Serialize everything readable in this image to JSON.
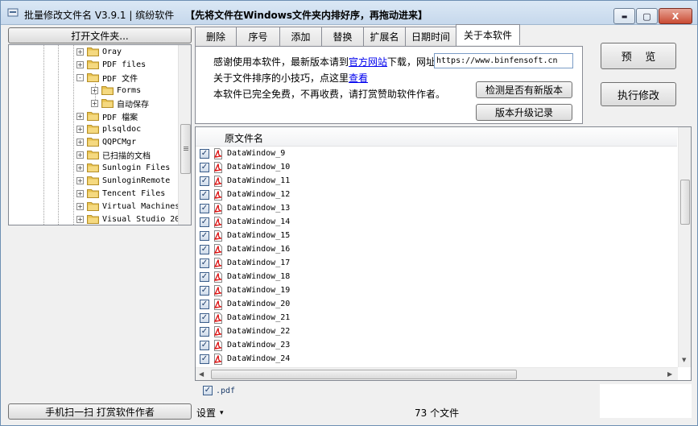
{
  "window": {
    "title_main": "批量修改文件名 V3.9.1 | 缤纷软件",
    "title_hint": "【先将文件在Windows文件夹内排好序，再拖动进来】",
    "min_label": "▬",
    "max_label": "▢",
    "close_label": "X"
  },
  "left": {
    "open_folder_label": "打开文件夹...",
    "donate_label": "手机扫一扫 打赏软件作者",
    "tree_items": [
      {
        "label": "Oray",
        "expander": "+",
        "indent": 0
      },
      {
        "label": "PDF files",
        "expander": "+",
        "indent": 0
      },
      {
        "label": "PDF 文件",
        "expander": "-",
        "indent": 0
      },
      {
        "label": "Forms",
        "expander": "+",
        "indent": 1
      },
      {
        "label": "自动保存",
        "expander": "+",
        "indent": 1
      },
      {
        "label": "PDF 檔案",
        "expander": "+",
        "indent": 0
      },
      {
        "label": "plsqldoc",
        "expander": "+",
        "indent": 0
      },
      {
        "label": "QQPCMgr",
        "expander": "+",
        "indent": 0
      },
      {
        "label": "已扫描的文档",
        "expander": "+",
        "indent": 0
      },
      {
        "label": "Sunlogin Files",
        "expander": "+",
        "indent": 0
      },
      {
        "label": "SunloginRemote",
        "expander": "+",
        "indent": 0
      },
      {
        "label": "Tencent Files",
        "expander": "+",
        "indent": 0
      },
      {
        "label": "Virtual Machines",
        "expander": "+",
        "indent": 0
      },
      {
        "label": "Visual Studio 20",
        "expander": "+",
        "indent": 0
      }
    ]
  },
  "tabs": [
    {
      "label": "删除",
      "active": false
    },
    {
      "label": "序号",
      "active": false
    },
    {
      "label": "添加",
      "active": false
    },
    {
      "label": "替换",
      "active": false
    },
    {
      "label": "扩展名",
      "active": false
    },
    {
      "label": "日期时间",
      "active": false
    },
    {
      "label": "关于本软件",
      "active": true
    }
  ],
  "about": {
    "line1_pre": "感谢使用本软件，最新版本请到",
    "line1_link": "官方网站",
    "line1_post": "下载，网址",
    "url_value": "https://www.binfensoft.cn",
    "line2_pre": "关于文件排序的小技巧，点这里",
    "line2_link": "查看",
    "line3": "本软件已完全免费，不再收费，请打赏赞助软件作者。",
    "check_update_label": "检测是否有新版本",
    "changelog_label": "版本升级记录"
  },
  "actions": {
    "preview_label": "预    览",
    "execute_label": "执行修改"
  },
  "file_list": {
    "column_header": "原文件名",
    "files": [
      {
        "name": "DataWindow_9",
        "checked": true
      },
      {
        "name": "DataWindow_10",
        "checked": true
      },
      {
        "name": "DataWindow_11",
        "checked": true
      },
      {
        "name": "DataWindow_12",
        "checked": true
      },
      {
        "name": "DataWindow_13",
        "checked": true
      },
      {
        "name": "DataWindow_14",
        "checked": true
      },
      {
        "name": "DataWindow_15",
        "checked": true
      },
      {
        "name": "DataWindow_16",
        "checked": true
      },
      {
        "name": "DataWindow_17",
        "checked": true
      },
      {
        "name": "DataWindow_18",
        "checked": true
      },
      {
        "name": "DataWindow_19",
        "checked": true
      },
      {
        "name": "DataWindow_20",
        "checked": true
      },
      {
        "name": "DataWindow_21",
        "checked": true
      },
      {
        "name": "DataWindow_22",
        "checked": true
      },
      {
        "name": "DataWindow_23",
        "checked": true
      },
      {
        "name": "DataWindow_24",
        "checked": true
      }
    ]
  },
  "filter": {
    "ext_label": ".pdf",
    "checked": true
  },
  "status": {
    "settings_label": "设置",
    "settings_arrow": "▾",
    "file_count": "73 个文件"
  },
  "icons": {
    "folder": "folder-icon",
    "pdf": "pdf-file-icon",
    "check": "✓"
  },
  "colors": {
    "accent_link": "#0000ee",
    "close_red": "#c94b33",
    "folder_yellow": "#e8c250"
  }
}
